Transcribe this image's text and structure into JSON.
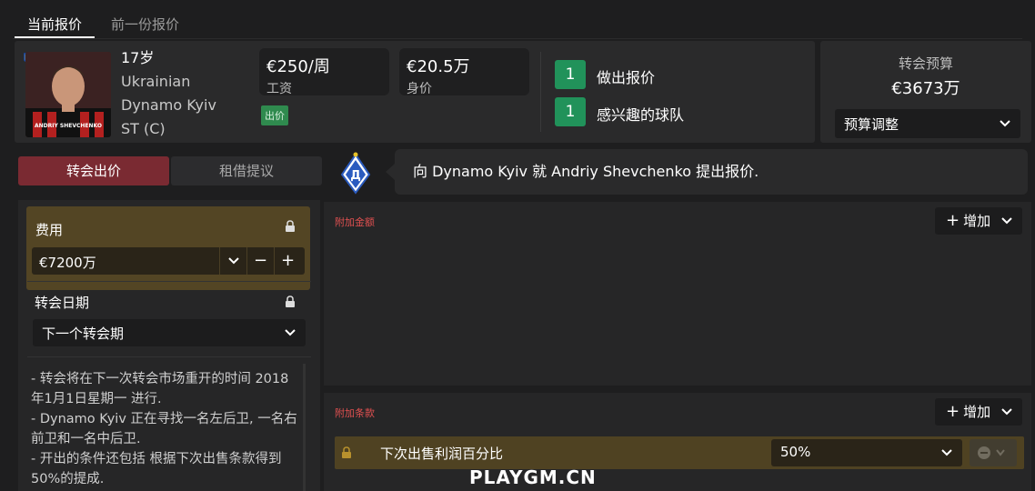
{
  "tabs": [
    {
      "label": "当前报价",
      "active": true
    },
    {
      "label": "前一份报价",
      "active": false
    }
  ],
  "player": {
    "age": "17岁",
    "nationality": "Ukrainian",
    "club": "Dynamo Kyiv",
    "position": "ST (C)",
    "shirt_name": "ANDRIY SHEVCHENKO"
  },
  "stats": {
    "wage_value": "€250/周",
    "wage_label": "工资",
    "value_value": "€20.5万",
    "value_label": "身价",
    "status_badge": "出价"
  },
  "interest": [
    {
      "count": "1",
      "label": "做出报价"
    },
    {
      "count": "1",
      "label": "感兴趣的球队"
    }
  ],
  "budget": {
    "label": "转会预算",
    "value": "€3673万",
    "select": "预算调整"
  },
  "offer_tabs": {
    "transfer": "转会出价",
    "loan": "租借提议"
  },
  "message": "向 Dynamo Kyiv 就 Andriy Shevchenko 提出报价.",
  "fee": {
    "label": "费用",
    "value": "€7200万",
    "minus": "−",
    "plus": "+"
  },
  "transfer_date": {
    "label": "转会日期",
    "value": "下一个转会期"
  },
  "notes": [
    "- 转会将在下一次转会市场重开的时间 2018年1月1日星期一 进行.",
    "- Dynamo Kyiv 正在寻找一名左后卫, 一名右前卫和一名中后卫.",
    "- 开出的条件还包括 根据下次出售条款得到50%的提成."
  ],
  "bonuses": {
    "title": "附加金额",
    "add_label": "增加"
  },
  "clauses": {
    "title": "附加条款",
    "add_label": "增加",
    "rows": [
      {
        "name": "下次出售利润百分比",
        "value": "50%"
      }
    ]
  },
  "watermark": "PLAYGM.CN",
  "colors": {
    "accent_red": "#7a2a32",
    "count_green": "#21925a",
    "fee_gold": "#534524",
    "title_red": "#e05050"
  }
}
